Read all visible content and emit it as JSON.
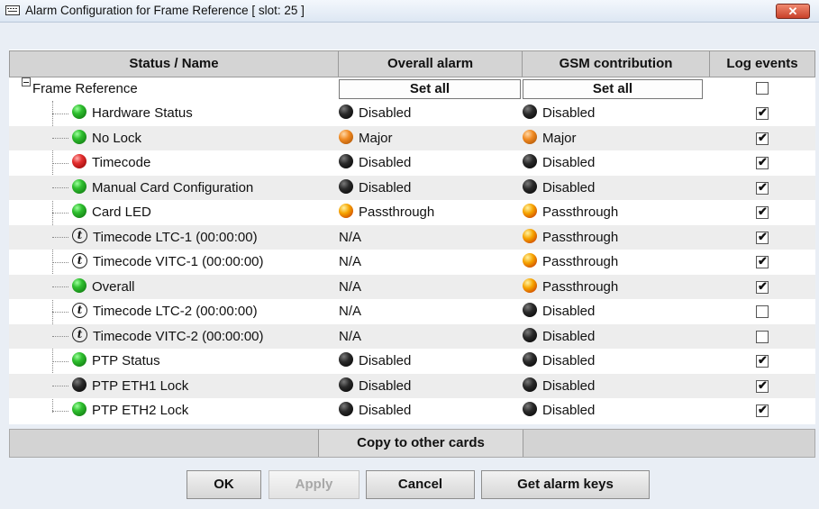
{
  "window": {
    "title": "Alarm Configuration for Frame Reference [ slot: 25 ]",
    "close_icon": "close-icon"
  },
  "table": {
    "headers": [
      "Status / Name",
      "Overall alarm",
      "GSM contribution",
      "Log events"
    ],
    "root": {
      "label": "Frame Reference",
      "set_all_overall": "Set all",
      "set_all_gsm": "Set all",
      "log_checked": false
    },
    "rows": [
      {
        "status_icon": "green",
        "name": "Hardware Status",
        "overall_icon": "black",
        "overall": "Disabled",
        "gsm_icon": "black",
        "gsm": "Disabled",
        "log": true
      },
      {
        "status_icon": "green",
        "name": "No Lock",
        "overall_icon": "orange",
        "overall": "Major",
        "gsm_icon": "orange",
        "gsm": "Major",
        "log": true
      },
      {
        "status_icon": "red",
        "name": "Timecode",
        "overall_icon": "black",
        "overall": "Disabled",
        "gsm_icon": "black",
        "gsm": "Disabled",
        "log": true
      },
      {
        "status_icon": "green",
        "name": "Manual Card Configuration",
        "overall_icon": "black",
        "overall": "Disabled",
        "gsm_icon": "black",
        "gsm": "Disabled",
        "log": true
      },
      {
        "status_icon": "green",
        "name": "Card LED",
        "overall_icon": "amber",
        "overall": "Passthrough",
        "gsm_icon": "amber",
        "gsm": "Passthrough",
        "log": true
      },
      {
        "status_icon": "info",
        "name": "Timecode LTC-1 (00:00:00)",
        "overall_icon": "",
        "overall": "N/A",
        "gsm_icon": "amber",
        "gsm": "Passthrough",
        "log": true
      },
      {
        "status_icon": "info",
        "name": "Timecode VITC-1 (00:00:00)",
        "overall_icon": "",
        "overall": "N/A",
        "gsm_icon": "amber",
        "gsm": "Passthrough",
        "log": true
      },
      {
        "status_icon": "green",
        "name": "Overall",
        "overall_icon": "",
        "overall": "N/A",
        "gsm_icon": "amber",
        "gsm": "Passthrough",
        "log": true
      },
      {
        "status_icon": "info",
        "name": "Timecode LTC-2 (00:00:00)",
        "overall_icon": "",
        "overall": "N/A",
        "gsm_icon": "black",
        "gsm": "Disabled",
        "log": false
      },
      {
        "status_icon": "info",
        "name": "Timecode VITC-2 (00:00:00)",
        "overall_icon": "",
        "overall": "N/A",
        "gsm_icon": "black",
        "gsm": "Disabled",
        "log": false
      },
      {
        "status_icon": "green",
        "name": "PTP Status",
        "overall_icon": "black",
        "overall": "Disabled",
        "gsm_icon": "black",
        "gsm": "Disabled",
        "log": true
      },
      {
        "status_icon": "black",
        "name": "PTP ETH1 Lock",
        "overall_icon": "black",
        "overall": "Disabled",
        "gsm_icon": "black",
        "gsm": "Disabled",
        "log": true
      },
      {
        "status_icon": "green",
        "name": "PTP ETH2 Lock",
        "overall_icon": "black",
        "overall": "Disabled",
        "gsm_icon": "black",
        "gsm": "Disabled",
        "log": true
      }
    ]
  },
  "copy_button": "Copy to other cards",
  "buttons": {
    "ok": "OK",
    "apply": "Apply",
    "cancel": "Cancel",
    "get_alarm_keys": "Get alarm keys"
  },
  "colors": {
    "title_bar": "#dde7f3",
    "header_bg": "#d4d4d4",
    "close_red": "#c8412a"
  }
}
